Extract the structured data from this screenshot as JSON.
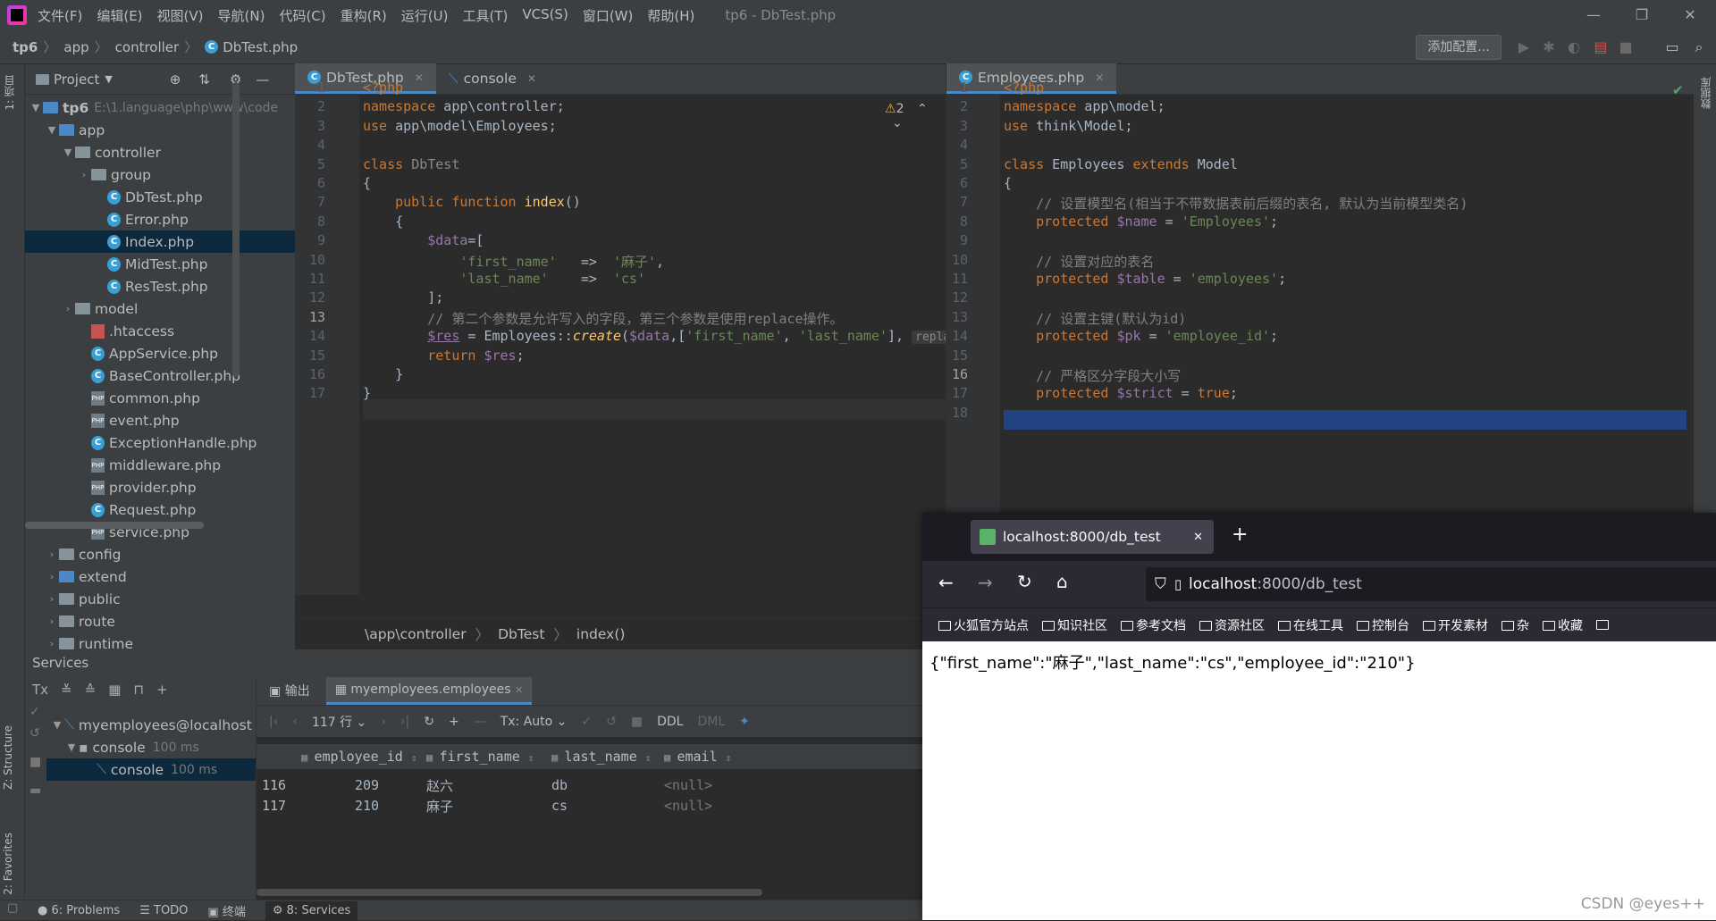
{
  "menu": {
    "items": [
      "文件(F)",
      "编辑(E)",
      "视图(V)",
      "导航(N)",
      "代码(C)",
      "重构(R)",
      "运行(U)",
      "工具(T)",
      "VCS(S)",
      "窗口(W)",
      "帮助(H)"
    ],
    "window_title": "tp6 - DbTest.php"
  },
  "breadcrumb": [
    "tp6",
    "app",
    "controller",
    "DbTest.php"
  ],
  "toolbar": {
    "add_config": "添加配置..."
  },
  "side_tabs": {
    "project": "1: 项目",
    "structure": "Z: Structure",
    "favorites": "2: Favorites",
    "database": "数据库"
  },
  "project": {
    "title": "Project",
    "root_name": "tp6",
    "root_path": "E:\\1.language\\php\\www\\code",
    "rows": [
      {
        "label": "app",
        "kind": "folder-blue",
        "level": 1,
        "arrow": "open"
      },
      {
        "label": "controller",
        "kind": "folder",
        "level": 2,
        "arrow": "open"
      },
      {
        "label": "group",
        "kind": "folder",
        "level": 3,
        "arrow": "closed"
      },
      {
        "label": "DbTest.php",
        "kind": "phpc",
        "level": 4
      },
      {
        "label": "Error.php",
        "kind": "phpc",
        "level": 4
      },
      {
        "label": "Index.php",
        "kind": "phpc",
        "level": 4,
        "selected": true
      },
      {
        "label": "MidTest.php",
        "kind": "phpc",
        "level": 4
      },
      {
        "label": "ResTest.php",
        "kind": "phpc",
        "level": 4
      },
      {
        "label": "model",
        "kind": "folder",
        "level": 2,
        "arrow": "closed"
      },
      {
        "label": ".htaccess",
        "kind": "ht",
        "level": 3
      },
      {
        "label": "AppService.php",
        "kind": "phpc",
        "level": 3
      },
      {
        "label": "BaseController.php",
        "kind": "phpc",
        "level": 3
      },
      {
        "label": "common.php",
        "kind": "php",
        "level": 3
      },
      {
        "label": "event.php",
        "kind": "php",
        "level": 3
      },
      {
        "label": "ExceptionHandle.php",
        "kind": "phpc",
        "level": 3
      },
      {
        "label": "middleware.php",
        "kind": "php",
        "level": 3
      },
      {
        "label": "provider.php",
        "kind": "php",
        "level": 3
      },
      {
        "label": "Request.php",
        "kind": "phpc",
        "level": 3
      },
      {
        "label": "service.php",
        "kind": "php",
        "level": 3
      },
      {
        "label": "config",
        "kind": "folder",
        "level": 1,
        "arrow": "closed"
      },
      {
        "label": "extend",
        "kind": "folder-blue",
        "level": 1,
        "arrow": "closed"
      },
      {
        "label": "public",
        "kind": "folder",
        "level": 1,
        "arrow": "closed"
      },
      {
        "label": "route",
        "kind": "folder",
        "level": 1,
        "arrow": "closed"
      },
      {
        "label": "runtime",
        "kind": "folder",
        "level": 1,
        "arrow": "closed"
      }
    ]
  },
  "editor_left": {
    "tabs": [
      {
        "label": "DbTest.php",
        "active": true
      },
      {
        "label": "console",
        "active": false
      }
    ],
    "warning_count": "2",
    "current_line": 13,
    "breadcrumb": [
      "\\app\\controller",
      "DbTest",
      "index()"
    ],
    "lines": [
      "<span class=\"tag\">&lt;?php</span>",
      "<span class=\"kw\">namespace</span> app\\controller;",
      "<span class=\"kw\">use</span> app\\model\\Employees;",
      "",
      "<span class=\"kw\">class</span> <span style=\"color:#888\">DbTest</span>",
      "{",
      "    <span class=\"kw\">public function</span> <span class=\"fn\">index</span>()",
      "    {",
      "        <span class=\"var\">$data</span>=[",
      "            <span class=\"str\">'first_name'</span>   =>  <span class=\"str\">'麻子'</span>,",
      "            <span class=\"str\">'last_name'</span>    =>  <span class=\"str\">'cs'</span>",
      "        ];",
      "        <span class=\"cm\">// 第二个参数是允许写入的字段，第三个参数是使用replace操作。</span>",
      "        <span class=\"var\" style=\"text-decoration:underline\">$res</span> = Employees::<span class=\"fn ital\">create</span>(<span class=\"var\">$data</span>,[<span class=\"str\">'first_name'</span>, <span class=\"str\">'last_name'</span>], <span class=\"hint\">replace:</span> <span class=\"kw\">true</span>);",
      "        <span class=\"kw\">return</span> <span class=\"var\">$res</span>;",
      "    }",
      "}"
    ]
  },
  "editor_right": {
    "tabs": [
      {
        "label": "Employees.php",
        "active": true
      }
    ],
    "current_line": 16,
    "lines": [
      "<span class=\"tag\">&lt;?php</span>",
      "<span class=\"kw\">namespace</span> app\\model;",
      "<span class=\"kw\">use</span> think\\Model;",
      "",
      "<span class=\"kw\">class</span> Employees <span class=\"kw\">extends</span> Model",
      "{",
      "    <span class=\"cm\">// 设置模型名(相当于不带数据表前后缀的表名, 默认为当前模型类名)</span>",
      "    <span class=\"kw\">protected</span> <span class=\"var\">$name</span> = <span class=\"str\">'Employees'</span>;",
      "",
      "    <span class=\"cm\">// 设置对应的表名</span>",
      "    <span class=\"kw\">protected</span> <span class=\"var\">$table</span> = <span class=\"str\">'employees'</span>;",
      "",
      "    <span class=\"cm\">// 设置主键(默认为id)</span>",
      "    <span class=\"kw\">protected</span> <span class=\"var\">$pk</span> = <span class=\"str\">'employee_id'</span>;",
      "",
      "    <span class=\"cm\">// 严格区分字段大小写</span>",
      "    <span class=\"kw\">protected</span> <span class=\"var\">$strict</span> = <span class=\"kw\">true</span>;",
      ""
    ]
  },
  "services": {
    "title": "Services",
    "tree": [
      {
        "label": "myemployees@localhost",
        "time": ""
      },
      {
        "label": "console",
        "time": "100 ms"
      },
      {
        "label": "console",
        "time": "100 ms",
        "selected": true
      }
    ],
    "tabs": [
      {
        "label": "输出"
      },
      {
        "label": "myemployees.employees",
        "active": true
      }
    ],
    "row_count": "117 行",
    "tx": "Tx: Auto",
    "ddl": "DDL",
    "dml": "DML",
    "columns": [
      "employee_id",
      "first_name",
      "last_name",
      "email"
    ],
    "rows": [
      {
        "n": "116",
        "employee_id": "209",
        "first_name": "赵六",
        "last_name": "db",
        "email": "<null>"
      },
      {
        "n": "117",
        "employee_id": "210",
        "first_name": "麻子",
        "last_name": "cs",
        "email": "<null>"
      }
    ]
  },
  "bottom_tabs": [
    {
      "label": "6: Problems",
      "icon": "problems-icon"
    },
    {
      "label": "TODO",
      "icon": "todo-icon"
    },
    {
      "label": "终端",
      "icon": "terminal-icon"
    },
    {
      "label": "8: Services",
      "icon": "services-icon",
      "active": true
    }
  ],
  "browser": {
    "tab_title": "localhost:8000/db_test",
    "url_host": "localhost",
    "url_rest": ":8000/db_test",
    "bookmarks": [
      "火狐官方站点",
      "知识社区",
      "参考文档",
      "资源社区",
      "在线工具",
      "控制台",
      "开发素材",
      "杂",
      "收藏",
      ""
    ],
    "body": "{\"first_name\":\"麻子\",\"last_name\":\"cs\",\"employee_id\":\"210\"}"
  },
  "watermark": "CSDN @eyes++"
}
